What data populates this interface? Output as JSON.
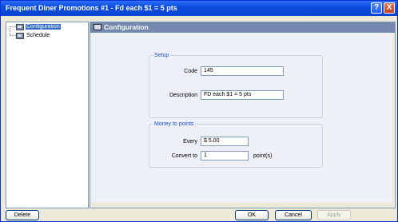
{
  "window": {
    "title": "Frequent Diner Promotions #1 - Fd each $1 = 5 pts",
    "help_glyph": "?",
    "close_glyph": "X"
  },
  "tree": {
    "items": [
      {
        "label": "Configuration",
        "selected": true
      },
      {
        "label": "Schedule",
        "selected": false
      }
    ]
  },
  "panel": {
    "title": "Configuration"
  },
  "setup": {
    "legend": "Setup",
    "code_label": "Code",
    "code_value": "145",
    "description_label": "Description",
    "description_value": "FD each $1 = 5 pts"
  },
  "money": {
    "legend": "Money to points",
    "every_label": "Every",
    "every_value": "$ 5.00",
    "convert_label": "Convert to",
    "convert_value": "1",
    "unit": "point(s)"
  },
  "buttons": {
    "delete": "Delete",
    "ok": "OK",
    "cancel": "Cancel",
    "apply": "Apply"
  },
  "colors": {
    "titlebar": "#0a44d0",
    "panel_header": "#7489ad",
    "selection": "#316ac5",
    "legend": "#1a4fd0"
  }
}
